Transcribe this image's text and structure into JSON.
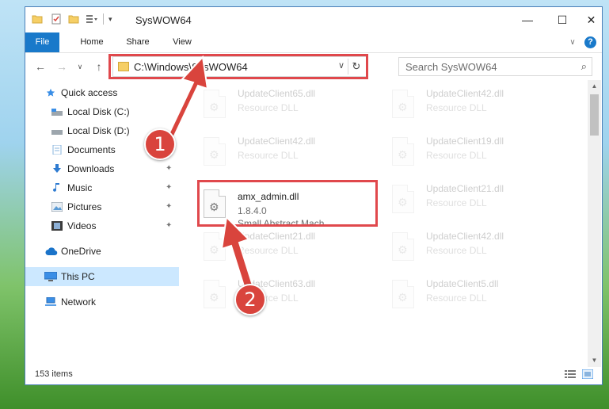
{
  "window": {
    "title": "SysWOW64",
    "min_glyph": "—",
    "max_glyph": "☐",
    "close_glyph": "✕"
  },
  "ribbon": {
    "tabs": [
      "File",
      "Home",
      "Share",
      "View"
    ],
    "help_glyph": "?",
    "expand_glyph": "∨"
  },
  "nav": {
    "back_glyph": "←",
    "forward_glyph": "→",
    "recent_glyph": "∨",
    "up_glyph": "↑"
  },
  "address": {
    "path": "C:\\Windows\\SysWOW64",
    "dropdown_glyph": "∨",
    "refresh_glyph": "↻"
  },
  "search": {
    "placeholder": "Search SysWOW64",
    "icon_glyph": "⌕"
  },
  "sidebar": {
    "items": [
      {
        "label": "Quick access",
        "icon": "star-icon",
        "pinned": false
      },
      {
        "label": "Local Disk (C:)",
        "icon": "drive-icon",
        "pinned": false
      },
      {
        "label": "Local Disk (D:)",
        "icon": "drive-icon",
        "pinned": false
      },
      {
        "label": "Documents",
        "icon": "documents-icon",
        "pinned": false
      },
      {
        "label": "Downloads",
        "icon": "download-icon",
        "pinned": true
      },
      {
        "label": "Music",
        "icon": "music-icon",
        "pinned": true
      },
      {
        "label": "Pictures",
        "icon": "pictures-icon",
        "pinned": true
      },
      {
        "label": "Videos",
        "icon": "videos-icon",
        "pinned": true
      },
      {
        "label": "OneDrive",
        "icon": "cloud-icon",
        "pinned": false
      },
      {
        "label": "This PC",
        "icon": "monitor-icon",
        "pinned": false,
        "selected": true
      },
      {
        "label": "Network",
        "icon": "network-icon",
        "pinned": false
      }
    ],
    "pin_glyph": "📌"
  },
  "files": [
    {
      "name": "UpdateClient65.dll",
      "type": "Resource DLL"
    },
    {
      "name": "UpdateClient42.dll",
      "type": "Resource DLL"
    },
    {
      "name": "UpdateClient42.dll",
      "type": "Resource DLL"
    },
    {
      "name": "UpdateClient19.dll",
      "type": "Resource DLL"
    },
    {
      "name": "amx_admin.dll",
      "version": "1.8.4.0",
      "desc": "Small Abstract Mach..."
    },
    {
      "name": "UpdateClient21.dll",
      "type": "Resource DLL"
    },
    {
      "name": "UpdateClient21.dll",
      "type": "Resource DLL"
    },
    {
      "name": "UpdateClient42.dll",
      "type": "Resource DLL"
    },
    {
      "name": "UpdateClient63.dll",
      "type": "Resource DLL"
    },
    {
      "name": "UpdateClient5.dll",
      "type": "Resource DLL"
    }
  ],
  "status": {
    "item_count": "153 items"
  },
  "annotations": {
    "step1": "1",
    "step2": "2",
    "color": "#d9443d"
  }
}
